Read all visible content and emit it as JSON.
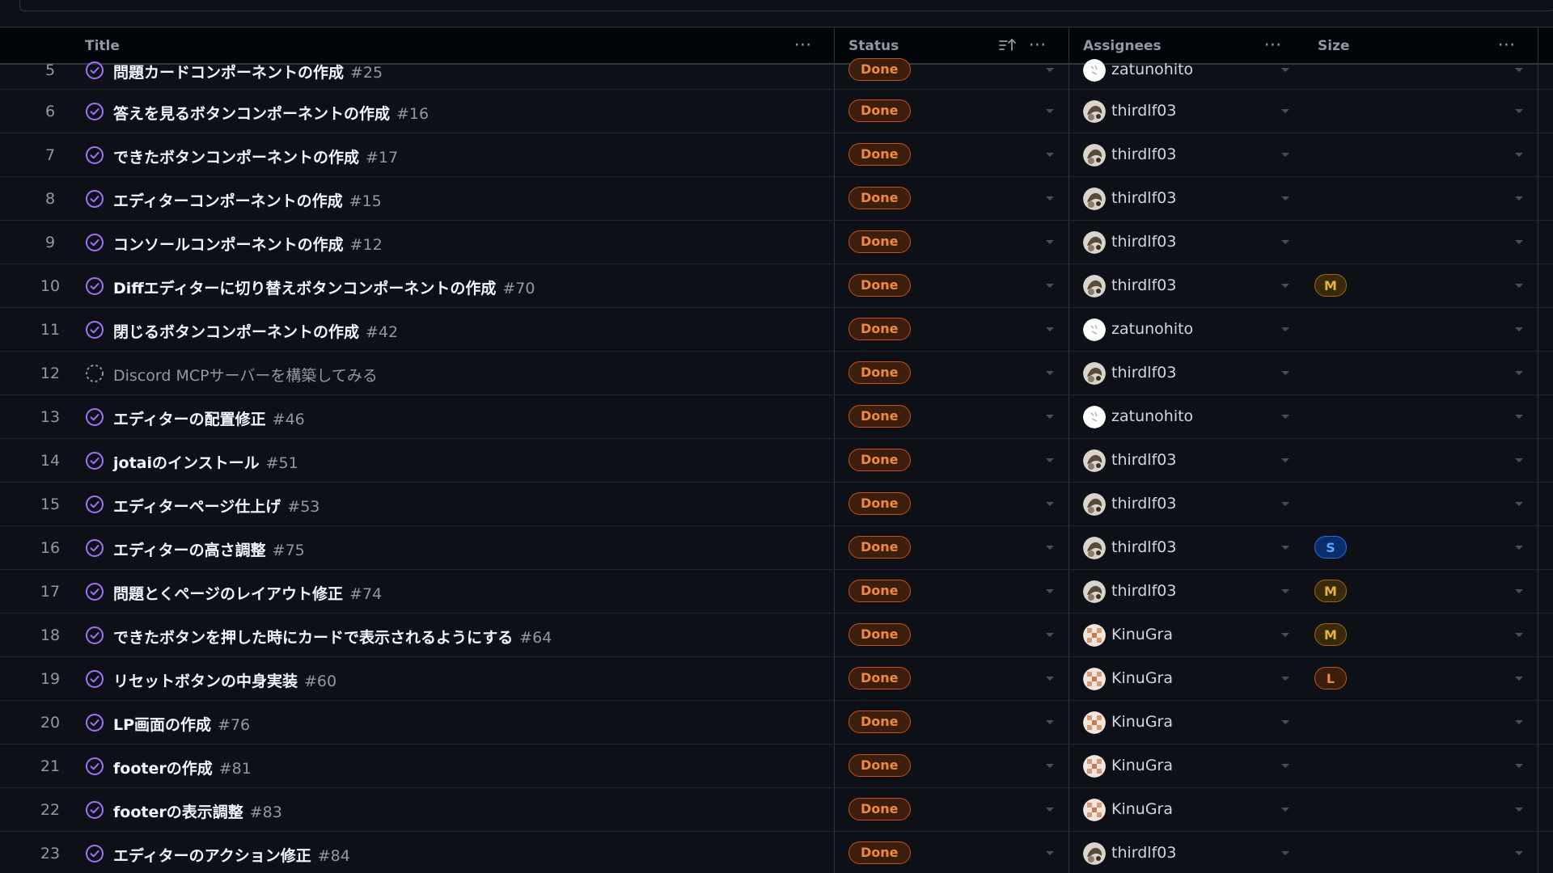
{
  "colors": {
    "background": "#0d1117",
    "done_text": "#f0883e",
    "done_border": "#c2511a",
    "closed_icon": "#a371f7",
    "draft_icon": "#9198a1"
  },
  "header": {
    "title": "Title",
    "status": "Status",
    "assignees": "Assignees",
    "size": "Size",
    "menu_icon": "kebab-horizontal-icon",
    "sort_icon": "sort-ascending-icon"
  },
  "rows": [
    {
      "n": "5",
      "title": "問題カードコンポーネントの作成",
      "issue": "#25",
      "draft": false,
      "status": "Done",
      "assignee": "zatunohito",
      "avatar": "zatunohito",
      "size": ""
    },
    {
      "n": "6",
      "title": "答えを見るボタンコンポーネントの作成",
      "issue": "#16",
      "draft": false,
      "status": "Done",
      "assignee": "thirdlf03",
      "avatar": "thirdlf03",
      "size": ""
    },
    {
      "n": "7",
      "title": "できたボタンコンポーネントの作成",
      "issue": "#17",
      "draft": false,
      "status": "Done",
      "assignee": "thirdlf03",
      "avatar": "thirdlf03",
      "size": ""
    },
    {
      "n": "8",
      "title": "エディターコンポーネントの作成",
      "issue": "#15",
      "draft": false,
      "status": "Done",
      "assignee": "thirdlf03",
      "avatar": "thirdlf03",
      "size": ""
    },
    {
      "n": "9",
      "title": "コンソールコンポーネントの作成",
      "issue": "#12",
      "draft": false,
      "status": "Done",
      "assignee": "thirdlf03",
      "avatar": "thirdlf03",
      "size": ""
    },
    {
      "n": "10",
      "title": "Diffエディターに切り替えボタンコンポーネントの作成",
      "issue": "#70",
      "draft": false,
      "status": "Done",
      "assignee": "thirdlf03",
      "avatar": "thirdlf03",
      "size": "M"
    },
    {
      "n": "11",
      "title": "閉じるボタンコンポーネントの作成",
      "issue": "#42",
      "draft": false,
      "status": "Done",
      "assignee": "zatunohito",
      "avatar": "zatunohito",
      "size": ""
    },
    {
      "n": "12",
      "title": "Discord MCPサーバーを構築してみる",
      "issue": "",
      "draft": true,
      "status": "Done",
      "assignee": "thirdlf03",
      "avatar": "thirdlf03",
      "size": ""
    },
    {
      "n": "13",
      "title": "エディターの配置修正",
      "issue": "#46",
      "draft": false,
      "status": "Done",
      "assignee": "zatunohito",
      "avatar": "zatunohito",
      "size": ""
    },
    {
      "n": "14",
      "title": "jotaiのインストール",
      "issue": "#51",
      "draft": false,
      "status": "Done",
      "assignee": "thirdlf03",
      "avatar": "thirdlf03",
      "size": ""
    },
    {
      "n": "15",
      "title": "エディターページ仕上げ",
      "issue": "#53",
      "draft": false,
      "status": "Done",
      "assignee": "thirdlf03",
      "avatar": "thirdlf03",
      "size": ""
    },
    {
      "n": "16",
      "title": "エディターの高さ調整",
      "issue": "#75",
      "draft": false,
      "status": "Done",
      "assignee": "thirdlf03",
      "avatar": "thirdlf03",
      "size": "S"
    },
    {
      "n": "17",
      "title": "問題とくページのレイアウト修正",
      "issue": "#74",
      "draft": false,
      "status": "Done",
      "assignee": "thirdlf03",
      "avatar": "thirdlf03",
      "size": "M"
    },
    {
      "n": "18",
      "title": "できたボタンを押した時にカードで表示されるようにする",
      "issue": "#64",
      "draft": false,
      "status": "Done",
      "assignee": "KinuGra",
      "avatar": "KinuGra",
      "size": "M"
    },
    {
      "n": "19",
      "title": "リセットボタンの中身実装",
      "issue": "#60",
      "draft": false,
      "status": "Done",
      "assignee": "KinuGra",
      "avatar": "KinuGra",
      "size": "L"
    },
    {
      "n": "20",
      "title": "LP画面の作成",
      "issue": "#76",
      "draft": false,
      "status": "Done",
      "assignee": "KinuGra",
      "avatar": "KinuGra",
      "size": ""
    },
    {
      "n": "21",
      "title": "footerの作成",
      "issue": "#81",
      "draft": false,
      "status": "Done",
      "assignee": "KinuGra",
      "avatar": "KinuGra",
      "size": ""
    },
    {
      "n": "22",
      "title": "footerの表示調整",
      "issue": "#83",
      "draft": false,
      "status": "Done",
      "assignee": "KinuGra",
      "avatar": "KinuGra",
      "size": ""
    },
    {
      "n": "23",
      "title": "エディターのアクション修正",
      "issue": "#84",
      "draft": false,
      "status": "Done",
      "assignee": "thirdlf03",
      "avatar": "thirdlf03",
      "size": ""
    }
  ]
}
